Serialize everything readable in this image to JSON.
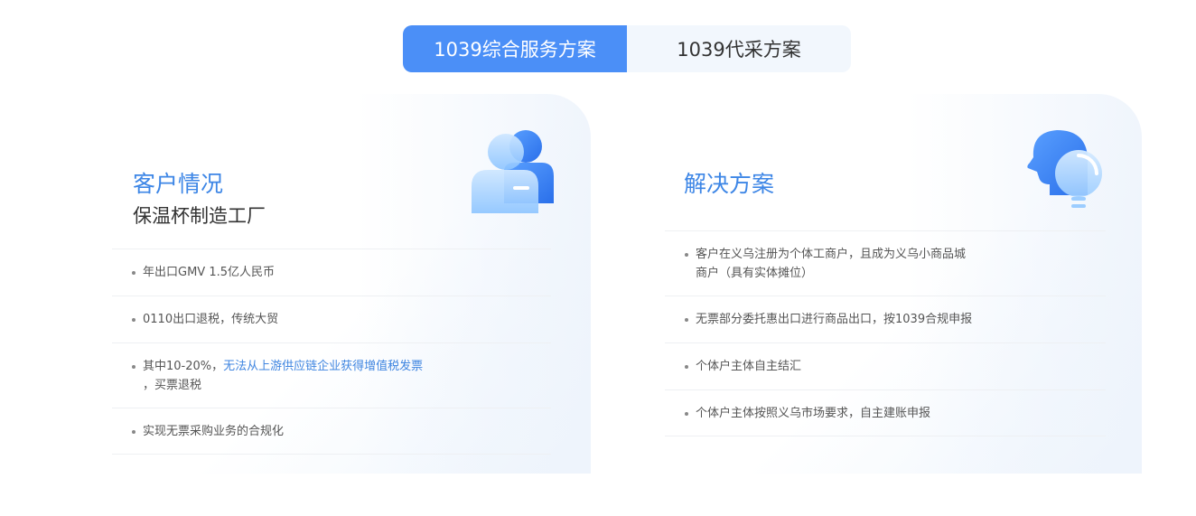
{
  "tabs": [
    {
      "label": "1039综合服务方案",
      "active": true
    },
    {
      "label": "1039代采方案",
      "active": false
    }
  ],
  "customer": {
    "title": "客户情况",
    "subtitle": "保温杯制造工厂",
    "items": [
      {
        "text": "年出口GMV 1.5亿人民币"
      },
      {
        "text": "0110出口退税，传统大贸"
      },
      {
        "prefix": "其中10-20%，",
        "highlight": "无法从上游供应链企业获得增值税发票",
        "suffix": "，买票退税"
      },
      {
        "text": "实现无票采购业务的合规化"
      }
    ]
  },
  "solution": {
    "title": "解决方案",
    "items": [
      {
        "line1": "客户在义乌注册为个体工商户，且成为义乌小商品城",
        "line2": "商户（具有实体摊位）"
      },
      {
        "text": "无票部分委托惠出口进行商品出口，按1039合规申报"
      },
      {
        "text": "个体户主体自主结汇"
      },
      {
        "text": "个体户主体按照义乌市场要求，自主建账申报"
      }
    ]
  },
  "colors": {
    "accent": "#4b8ff7",
    "title": "#3d86e6"
  },
  "icons": {
    "customer": "user-group-icon",
    "solution": "head-lightbulb-icon"
  }
}
